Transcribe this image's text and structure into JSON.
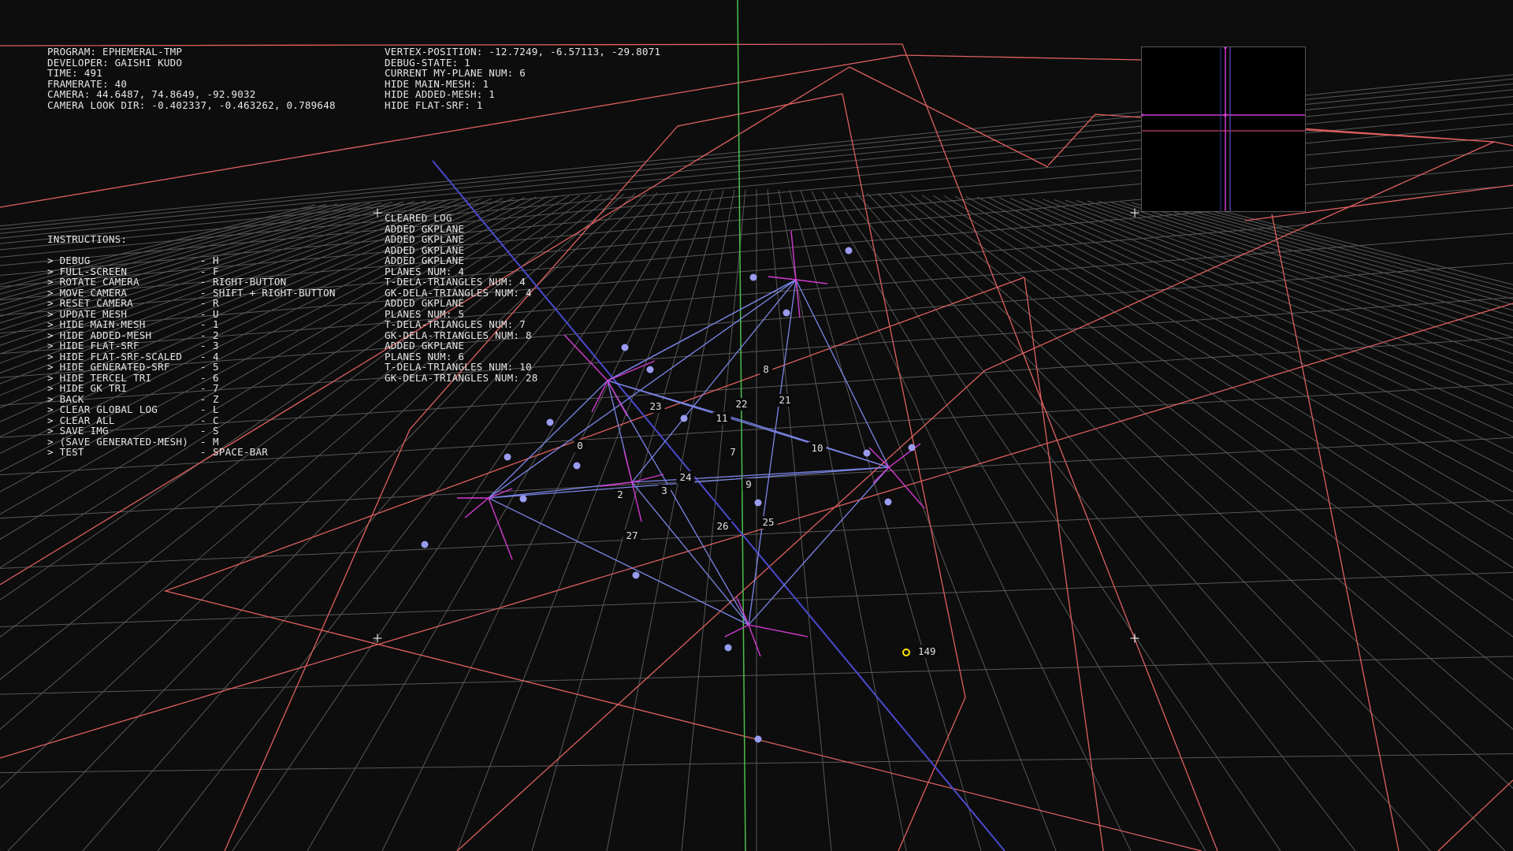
{
  "info_left": [
    "PROGRAM: EPHEMERAL-TMP",
    "DEVELOPER: GAISHI KUDO",
    "TIME: 491",
    "FRAMERATE: 40",
    "CAMERA: 44.6487, 74.8649, -92.9032",
    "CAMERA LOOK DIR: -0.402337, -0.463262, 0.789648"
  ],
  "info_right": [
    "VERTEX-POSITION: -12.7249, -6.57113, -29.8071",
    "DEBUG-STATE: 1",
    "CURRENT MY-PLANE NUM: 6",
    "HIDE MAIN-MESH: 1",
    "HIDE ADDED-MESH: 1",
    "HIDE FLAT-SRF: 1"
  ],
  "instructions": {
    "title": "INSTRUCTIONS:",
    "items": [
      {
        "label": "> DEBUG",
        "key": "H"
      },
      {
        "label": "> FULL-SCREEN",
        "key": "F"
      },
      {
        "label": "> ROTATE CAMERA",
        "key": "RIGHT-BUTTON"
      },
      {
        "label": "> MOVE CAMERA",
        "key": "SHIFT + RIGHT-BUTTON"
      },
      {
        "label": "> RESET CAMERA",
        "key": "R"
      },
      {
        "label": "> UPDATE MESH",
        "key": "U"
      },
      {
        "label": "> HIDE MAIN-MESH",
        "key": "1"
      },
      {
        "label": "> HIDE ADDED-MESH",
        "key": "2"
      },
      {
        "label": "> HIDE FLAT-SRF",
        "key": "3"
      },
      {
        "label": "> HIDE FLAT-SRF-SCALED",
        "key": "4"
      },
      {
        "label": "> HIDE GENERATED-SRF",
        "key": "5"
      },
      {
        "label": "> HIDE TERCEL TRI",
        "key": "6"
      },
      {
        "label": "> HIDE GK TRI",
        "key": "7"
      },
      {
        "label": "> BACK",
        "key": "Z"
      },
      {
        "label": "> CLEAR GLOBAL LOG",
        "key": "L"
      },
      {
        "label": "> CLEAR ALL",
        "key": "C"
      },
      {
        "label": "> SAVE IMG",
        "key": "S"
      },
      {
        "label": "> (SAVE GENERATED-MESH)",
        "key": "M"
      },
      {
        "label": "> TEST",
        "key": "SPACE-BAR"
      }
    ],
    "dash": "-"
  },
  "log": [
    "CLEARED LOG",
    "ADDED GKPLANE",
    "ADDED GKPLANE",
    "ADDED GKPLANE",
    "ADDED GKPLANE",
    "PLANES NUM: 4",
    "T-DELA-TRIANGLES NUM: 4",
    "GK-DELA-TRIANGLES NUM: 4",
    "ADDED GKPLANE",
    "PLANES NUM: 5",
    "T-DELA-TRIANGLES NUM: 7",
    "GK-DELA-TRIANGLES NUM: 8",
    "ADDED GKPLANE",
    "PLANES NUM: 6",
    "T-DELA-TRIANGLES NUM: 10",
    "GK-DELA-TRIANGLES NUM: 28"
  ],
  "triangle_labels": [
    "0",
    "2",
    "3",
    "7",
    "8",
    "9",
    "10",
    "11",
    "21",
    "22",
    "23",
    "24",
    "25",
    "26",
    "27"
  ],
  "cursor_label": "149",
  "colors": {
    "background": "#0d0d0d",
    "grid": "#6a6a6a",
    "plane_outline": "#e06060",
    "axis_y": "#4cc04c",
    "axis_blue": "#4a4ad0",
    "mesh_edge": "#7c86e8",
    "plane_normal": "#d33bd3",
    "vertex_dot": "#9a9cf0",
    "cursor": "#ffe600"
  }
}
